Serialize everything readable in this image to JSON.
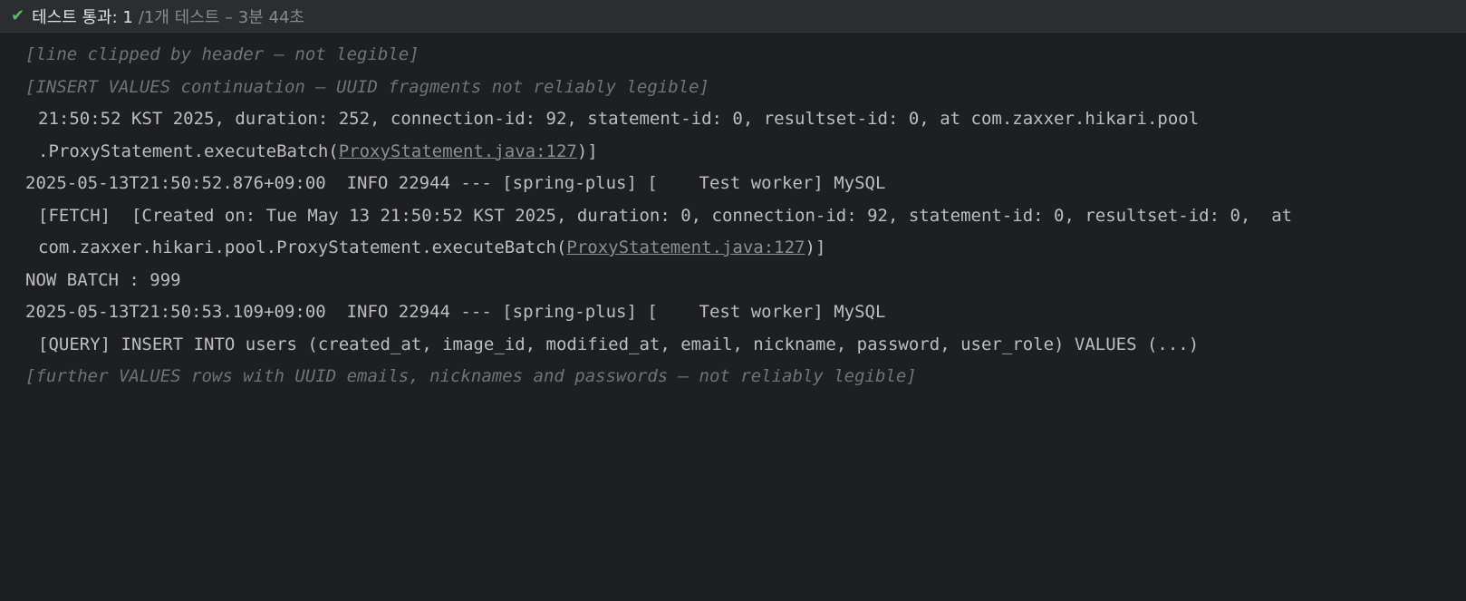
{
  "header": {
    "status_main": "테스트 통과: 1",
    "status_sub": "/1개 테스트 – 3분 44초"
  },
  "console": {
    "lines": [
      {
        "kind": "note",
        "text": "[line clipped by header — not legible]"
      },
      {
        "kind": "note",
        "text": "[INSERT VALUES continuation — UUID fragments not reliably legible]"
      },
      {
        "kind": "cont",
        "text": "21:50:52 KST 2025, duration: 252, connection-id: 92, statement-id: 0, resultset-id: 0, at com.zaxxer.hikari.pool"
      },
      {
        "kind": "cont",
        "text": ".ProxyStatement.executeBatch(",
        "link": "ProxyStatement.java:127",
        "suffix": ")]"
      },
      {
        "kind": "plain",
        "text": "2025-05-13T21:50:52.876+09:00  INFO 22944 --- [spring-plus] [    Test worker] MySQL"
      },
      {
        "kind": "cont",
        "text": "[FETCH]  [Created on: Tue May 13 21:50:52 KST 2025, duration: 0, connection-id: 92, statement-id: 0, resultset-id: 0,  at"
      },
      {
        "kind": "cont",
        "text": "com.zaxxer.hikari.pool.ProxyStatement.executeBatch(",
        "link": "ProxyStatement.java:127",
        "suffix": ")]"
      },
      {
        "kind": "plain",
        "text": "NOW BATCH : 999"
      },
      {
        "kind": "plain",
        "text": "2025-05-13T21:50:53.109+09:00  INFO 22944 --- [spring-plus] [    Test worker] MySQL"
      },
      {
        "kind": "cont",
        "text": "[QUERY] INSERT INTO users (created_at, image_id, modified_at, email, nickname, password, user_role) VALUES (...)"
      },
      {
        "kind": "note",
        "text": "[further VALUES rows with UUID emails, nicknames and passwords — not reliably legible]"
      }
    ]
  }
}
